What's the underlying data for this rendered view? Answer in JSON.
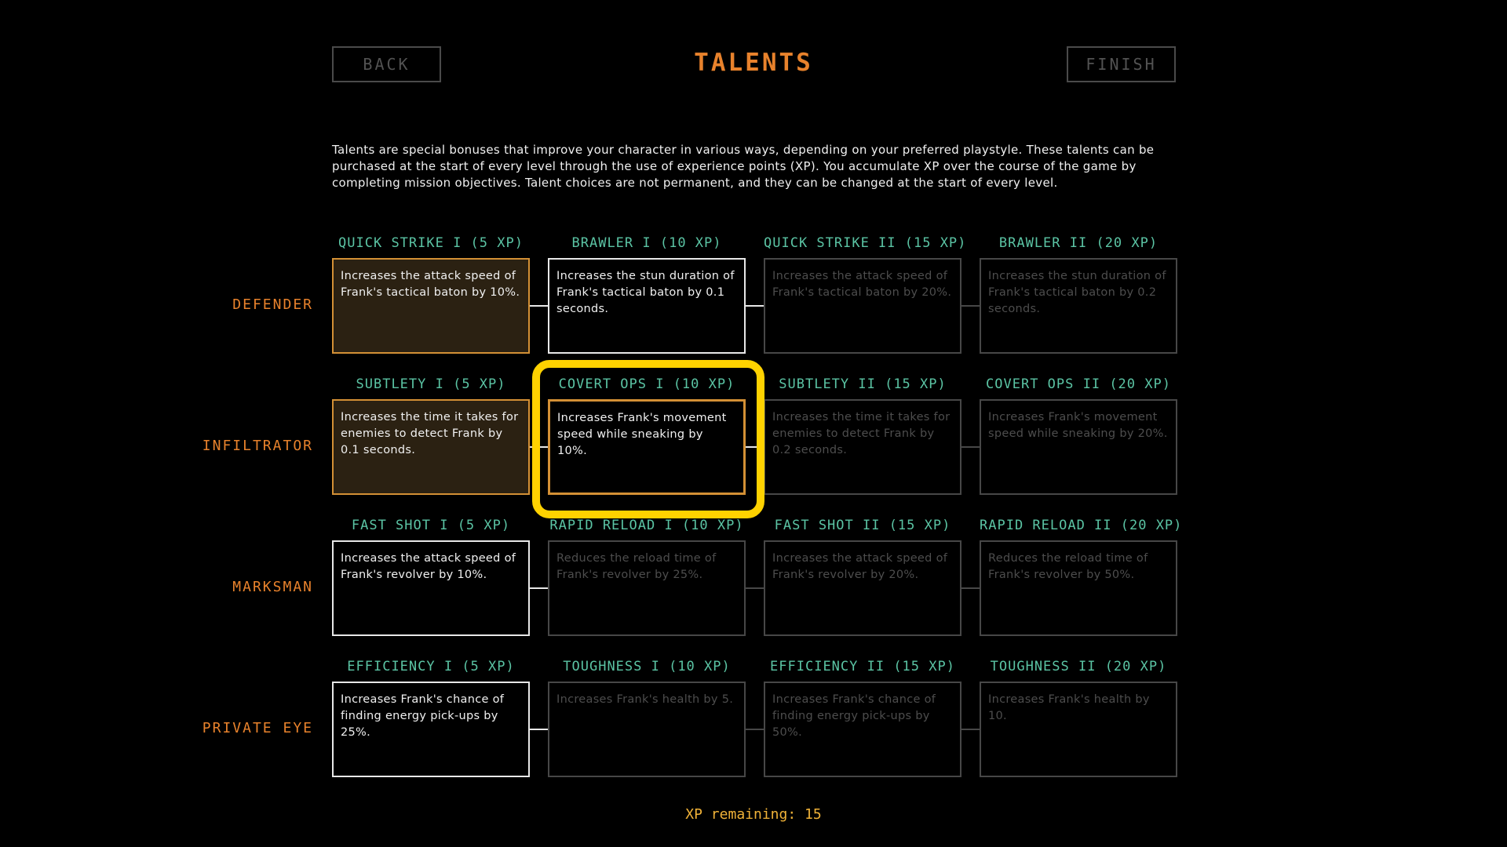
{
  "header": {
    "back_label": "BACK",
    "title": "TALENTS",
    "finish_label": "FINISH"
  },
  "intro": "Talents are special bonuses that improve your character in various ways, depending on your preferred playstyle. These talents can be purchased at the start of every level through the use of experience points (XP). You accumulate XP over the course of the game by completing mission objectives. Talent choices are not permanent, and they can be changed at the start of every level.",
  "rows": [
    {
      "label": "DEFENDER",
      "talents": [
        {
          "title": "QUICK STRIKE I (5 XP)",
          "desc": "Increases the attack speed of Frank's tactical baton by 10%.",
          "state": "purchased"
        },
        {
          "title": "BRAWLER I (10 XP)",
          "desc": "Increases the stun duration of Frank's tactical baton by 0.1 seconds.",
          "state": "available"
        },
        {
          "title": "QUICK STRIKE II (15 XP)",
          "desc": "Increases the attack speed of Frank's tactical baton by 20%.",
          "state": "locked"
        },
        {
          "title": "BRAWLER II (20 XP)",
          "desc": "Increases the stun duration of Frank's tactical baton by 0.2 seconds.",
          "state": "locked"
        }
      ],
      "connectors": [
        "on",
        "on",
        "off"
      ]
    },
    {
      "label": "INFILTRATOR",
      "talents": [
        {
          "title": "SUBTLETY I (5 XP)",
          "desc": "Increases the time it takes for enemies to detect Frank by 0.1 seconds.",
          "state": "purchased"
        },
        {
          "title": "COVERT OPS I (10 XP)",
          "desc": "Increases Frank's movement speed while sneaking by 10%.",
          "state": "selected"
        },
        {
          "title": "SUBTLETY II (15 XP)",
          "desc": "Increases the time it takes for enemies to detect Frank by 0.2 seconds.",
          "state": "locked"
        },
        {
          "title": "COVERT OPS II (20 XP)",
          "desc": "Increases Frank's movement speed while sneaking by 20%.",
          "state": "locked"
        }
      ],
      "connectors": [
        "on",
        "on",
        "off"
      ]
    },
    {
      "label": "MARKSMAN",
      "talents": [
        {
          "title": "FAST SHOT I (5 XP)",
          "desc": "Increases the attack speed of Frank's revolver by 10%.",
          "state": "available"
        },
        {
          "title": "RAPID RELOAD I (10 XP)",
          "desc": "Reduces the reload time of Frank's revolver by 25%.",
          "state": "locked"
        },
        {
          "title": "FAST SHOT II (15 XP)",
          "desc": "Increases the attack speed of Frank's revolver by 20%.",
          "state": "locked"
        },
        {
          "title": "RAPID RELOAD II (20 XP)",
          "desc": "Reduces the reload time of Frank's revolver by 50%.",
          "state": "locked"
        }
      ],
      "connectors": [
        "on",
        "off",
        "off"
      ]
    },
    {
      "label": "PRIVATE EYE",
      "talents": [
        {
          "title": "EFFICIENCY I (5 XP)",
          "desc": "Increases Frank's chance of finding energy pick-ups by 25%.",
          "state": "available"
        },
        {
          "title": "TOUGHNESS I (10 XP)",
          "desc": "Increases Frank's health by 5.",
          "state": "locked"
        },
        {
          "title": "EFFICIENCY II (15 XP)",
          "desc": "Increases Frank's chance of finding energy pick-ups by 50%.",
          "state": "locked"
        },
        {
          "title": "TOUGHNESS II (20 XP)",
          "desc": "Increases Frank's health by 10.",
          "state": "locked"
        }
      ],
      "connectors": [
        "on",
        "off",
        "off"
      ]
    }
  ],
  "xp_remaining": "XP remaining: 15",
  "colors": {
    "accent_orange": "#e8822c",
    "talent_title_teal": "#5bc4a4",
    "purchased_border": "#d39035",
    "highlight_yellow": "#ffd200",
    "xp_text": "#f0b238"
  }
}
